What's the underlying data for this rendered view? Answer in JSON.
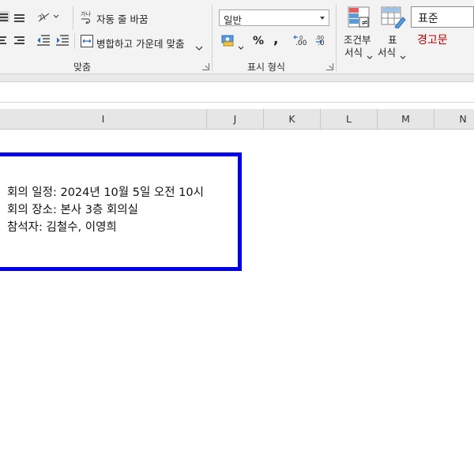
{
  "ribbon": {
    "alignment": {
      "wrap_text_label": "자동 줄 바꿈",
      "merge_center_label": "병합하고 가운데 맞춤",
      "group_label": "맞춤"
    },
    "number": {
      "format_value": "일반",
      "percent_symbol": "%",
      "comma_symbol": ",",
      "increase_decimal_label": ".00",
      "decrease_decimal_label": ".0",
      "group_label": "표시 형식"
    },
    "styles": {
      "conditional_format_line1": "조건부",
      "conditional_format_line2": "서식",
      "table_format_line1": "표",
      "table_format_line2": "서식",
      "cell_style_normal": "표준",
      "cell_style_warning": "경고문"
    }
  },
  "columns": [
    "I",
    "J",
    "K",
    "L",
    "M",
    "N"
  ],
  "textbox": {
    "lines": [
      "회의 일정: 2024년 10월 5일 오전 10시",
      "회의 장소: 본사 3층 회의실",
      "참석자: 김철수, 이영희"
    ]
  },
  "colors": {
    "textbox_border": "#0000e6",
    "warning_text": "#c00000"
  }
}
